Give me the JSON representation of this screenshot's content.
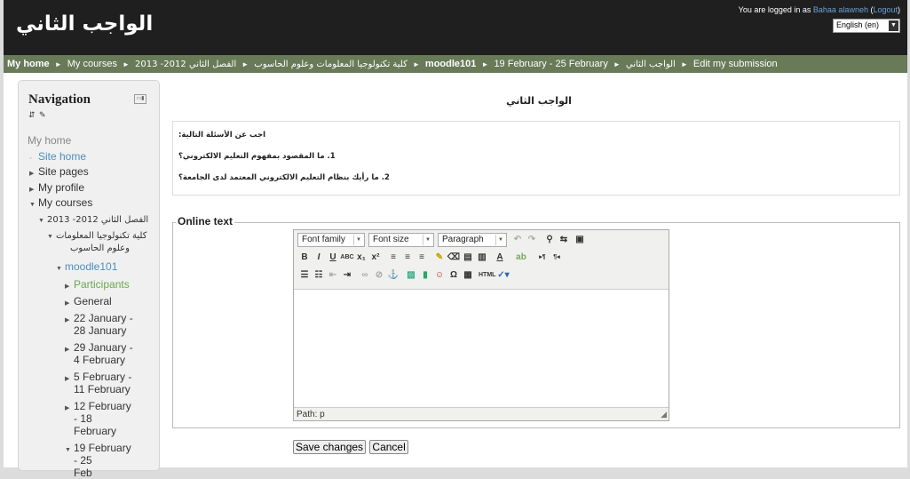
{
  "header": {
    "site_title": "الواجب الثاني",
    "logged_in_prefix": "You are logged in as ",
    "user_name": "Bahaa alawneh",
    "logout_open": " (",
    "logout_label": "Logout",
    "logout_close": ")",
    "language": "English (en)"
  },
  "breadcrumb": {
    "home": "My home",
    "sep": "►",
    "items": [
      "My courses",
      "كلية تكنولوجيا المعلومات وعلوم الحاسوب",
      "الفصل الثاني 2012- 2013",
      "moodle101",
      "19 February - 25 February",
      "الواجب الثاني",
      "Edit my submission"
    ]
  },
  "navigation": {
    "title": "Navigation",
    "subtitle": "⇵ ✎",
    "items": [
      {
        "label": "My home"
      },
      {
        "label": "Site home"
      },
      {
        "label": "Site pages"
      },
      {
        "label": "My profile"
      },
      {
        "label": "My courses"
      },
      {
        "label": "الفصل الثاني 2012- 2013"
      },
      {
        "label": "كلية تكنولوجيا المعلومات"
      },
      {
        "label": "وعلوم الحاسوب"
      },
      {
        "label": "moodle101"
      },
      {
        "label": "Participants"
      },
      {
        "label": "General"
      },
      {
        "label": "22 January -"
      },
      {
        "label": "28 January"
      },
      {
        "label": "29 January -"
      },
      {
        "label": "4 February"
      },
      {
        "label": "5 February -"
      },
      {
        "label": "11 February"
      },
      {
        "label": "12 February"
      },
      {
        "label": "- 18"
      },
      {
        "label": "February"
      },
      {
        "label": "19 February"
      },
      {
        "label": "- 25"
      },
      {
        "label": "Feb"
      }
    ]
  },
  "main": {
    "title": "الواجب الثاني",
    "description": [
      "اجب عن الأسئلة التالية:",
      "1. ما المقصود بمفهوم التعليم الالكتروني؟",
      "2. ما رأيك بنظام التعليم الالكتروني المعتمد لدى الجامعة؟"
    ],
    "online_text_legend": "Online text",
    "editor": {
      "font_family": "Font family",
      "font_size": "Font size",
      "format": "Paragraph",
      "path_label": "Path: p",
      "icons": [
        "undo-icon",
        "redo-icon",
        "find-icon",
        "replace-icon",
        "fullscreen-icon",
        "bold-icon",
        "italic-icon",
        "underline-icon",
        "strikethrough-icon",
        "subscript-icon",
        "superscript-icon",
        "align-left-icon",
        "align-center-icon",
        "align-right-icon",
        "cleanup-icon",
        "remove-format-icon",
        "paste-text-icon",
        "paste-word-icon",
        "text-color-icon",
        "highlight-color-icon",
        "ltr-icon",
        "rtl-icon",
        "bullet-list-icon",
        "numbered-list-icon",
        "outdent-icon",
        "indent-icon",
        "link-icon",
        "unlink-icon",
        "anchor-icon",
        "image-icon",
        "media-icon",
        "emoticon-icon",
        "special-char-icon",
        "table-icon",
        "html-icon",
        "spellcheck-icon"
      ]
    },
    "save_label": "Save changes",
    "cancel_label": "Cancel"
  }
}
